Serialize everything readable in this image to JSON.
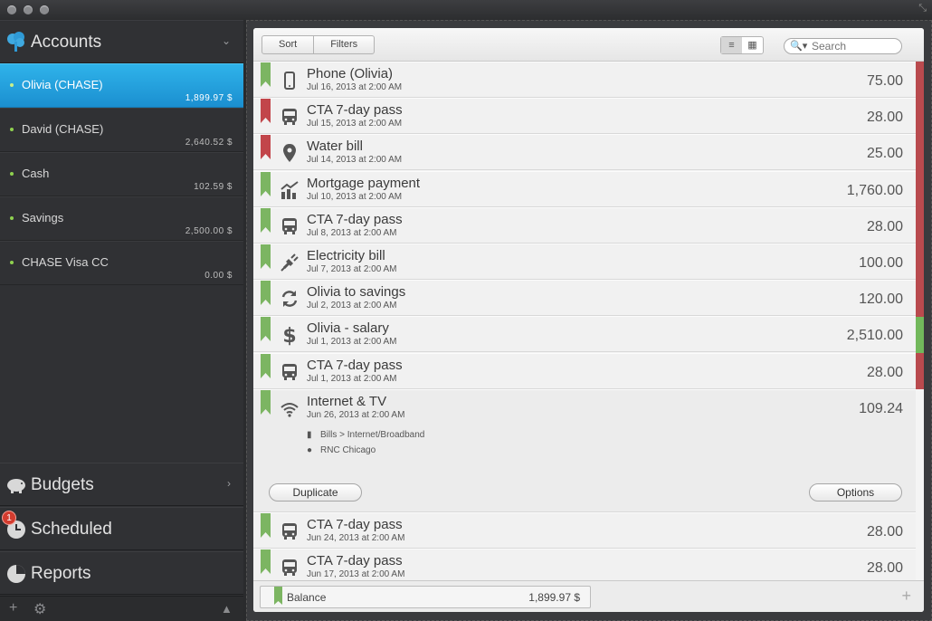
{
  "window": {
    "resize_icon": "resize-icon"
  },
  "sidebar": {
    "accounts_title": "Accounts",
    "accounts": [
      {
        "name": "Olivia (CHASE)",
        "balance": "1,899.97 $",
        "selected": true
      },
      {
        "name": "David (CHASE)",
        "balance": "2,640.52 $",
        "selected": false
      },
      {
        "name": "Cash",
        "balance": "102.59 $",
        "selected": false
      },
      {
        "name": "Savings",
        "balance": "2,500.00 $",
        "selected": false
      },
      {
        "name": "CHASE Visa CC",
        "balance": "0.00 $",
        "selected": false
      }
    ],
    "budgets_title": "Budgets",
    "scheduled_title": "Scheduled",
    "scheduled_badge": "1",
    "reports_title": "Reports"
  },
  "toolbar": {
    "sort_label": "Sort",
    "filters_label": "Filters",
    "search_placeholder": "Search"
  },
  "transactions": [
    {
      "name": "Phone (Olivia)",
      "date": "Jul 16, 2013 at 2:00 AM",
      "amount": "75.00",
      "flag": "green",
      "icon": "phone-icon",
      "stripe": "red"
    },
    {
      "name": "CTA 7-day pass",
      "date": "Jul 15, 2013 at 2:00 AM",
      "amount": "28.00",
      "flag": "red",
      "icon": "bus-icon",
      "stripe": "red"
    },
    {
      "name": "Water bill",
      "date": "Jul 14, 2013 at 2:00 AM",
      "amount": "25.00",
      "flag": "red",
      "icon": "location-pin-icon",
      "stripe": "red"
    },
    {
      "name": "Mortgage payment",
      "date": "Jul 10, 2013 at 2:00 AM",
      "amount": "1,760.00",
      "flag": "green",
      "icon": "growth-chart-icon",
      "stripe": "red"
    },
    {
      "name": "CTA 7-day pass",
      "date": "Jul 8, 2013 at 2:00 AM",
      "amount": "28.00",
      "flag": "green",
      "icon": "bus-icon",
      "stripe": "red"
    },
    {
      "name": "Electricity bill",
      "date": "Jul 7, 2013 at 2:00 AM",
      "amount": "100.00",
      "flag": "green",
      "icon": "plug-icon",
      "stripe": "red"
    },
    {
      "name": "Olivia to savings",
      "date": "Jul 2, 2013 at 2:00 AM",
      "amount": "120.00",
      "flag": "green",
      "icon": "transfer-icon",
      "stripe": "red"
    },
    {
      "name": "Olivia - salary",
      "date": "Jul 1, 2013 at 2:00 AM",
      "amount": "2,510.00",
      "flag": "green",
      "icon": "dollar-icon",
      "stripe": "green"
    },
    {
      "name": "CTA 7-day pass",
      "date": "Jul 1, 2013 at 2:00 AM",
      "amount": "28.00",
      "flag": "green",
      "icon": "bus-icon",
      "stripe": "red"
    }
  ],
  "expanded": {
    "name": "Internet & TV",
    "date": "Jun 26, 2013 at 2:00 AM",
    "amount": "109.24",
    "category": "Bills > Internet/Broadband",
    "payee": "RNC Chicago",
    "duplicate_label": "Duplicate",
    "options_label": "Options"
  },
  "after": [
    {
      "name": "CTA 7-day pass",
      "date": "Jun 24, 2013 at 2:00 AM",
      "amount": "28.00"
    },
    {
      "name": "CTA 7-day pass",
      "date": "Jun 17, 2013 at 2:00 AM",
      "amount": "28.00"
    }
  ],
  "footer": {
    "balance_label": "Balance",
    "balance_value": "1,899.97 $"
  },
  "colors": {
    "selection": "#1b8fd0",
    "flag_green": "#7cb562",
    "flag_red": "#c2454a",
    "stripe_red": "#b94a4e",
    "stripe_green": "#72b85b"
  }
}
